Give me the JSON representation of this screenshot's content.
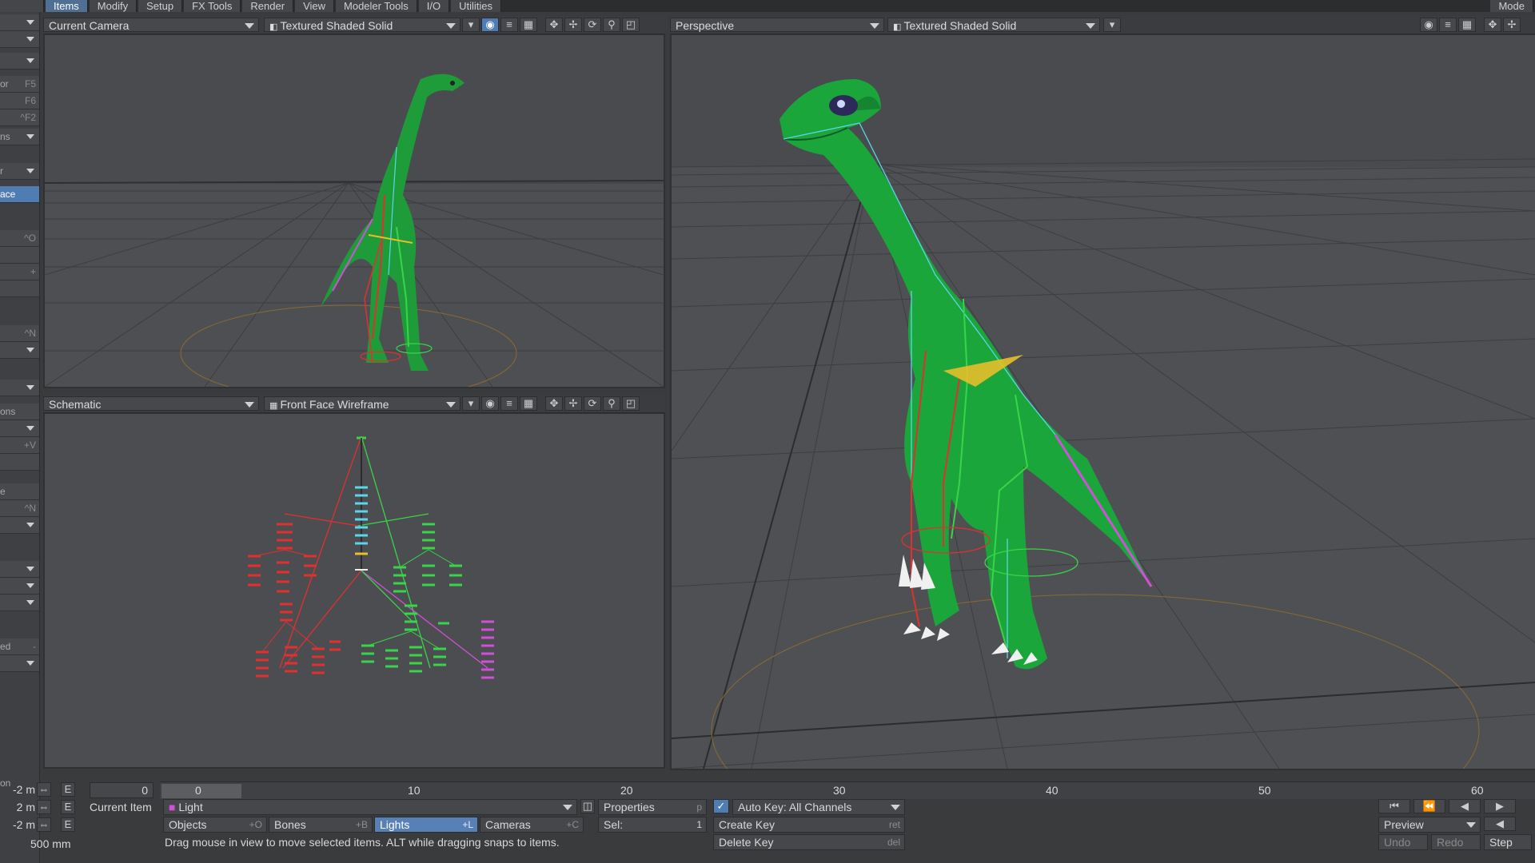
{
  "menu": {
    "tabs": [
      "Items",
      "Modify",
      "Setup",
      "FX Tools",
      "Render",
      "View",
      "Modeler Tools",
      "I/O",
      "Utilities"
    ],
    "right_label": "Mode"
  },
  "left_strip": {
    "shortcut_f5": "F5",
    "shortcut_f6": "F6",
    "shortcut_f2": "^F2",
    "item_or": "or",
    "item_ns": "ns",
    "item_r": "r",
    "item_ace": "ace",
    "shortcut_o": "^O",
    "shortcut_plus": "+",
    "shortcut_n": "^N",
    "item_ons": "ons",
    "shortcut_v": "+V",
    "item_e": "e",
    "shortcut_n2": "^N",
    "item_ed": "ed",
    "item_ed_sc": "-",
    "item_on": "on"
  },
  "viewport_tl": {
    "camera": "Current Camera",
    "render_mode": "Textured Shaded Solid"
  },
  "viewport_bl": {
    "view": "Schematic",
    "render_mode": "Front Face Wireframe"
  },
  "viewport_right": {
    "view": "Perspective",
    "render_mode": "Textured Shaded Solid"
  },
  "timeline": {
    "ticks": [
      "0",
      "10",
      "20",
      "30",
      "40",
      "50",
      "60"
    ],
    "current_frame": "0",
    "frame_field": "0",
    "pos_x": "-2 m",
    "pos_y": "2 m",
    "pos_z": "-2 m",
    "grid_size": "500 mm",
    "e_label": "E",
    "current_item_label": "Current Item",
    "current_item_value": "Light",
    "properties_label": "Properties",
    "properties_shortcut": "p",
    "autokey_label": "Auto Key: All Channels",
    "objects_label": "Objects",
    "objects_shortcut": "+O",
    "bones_label": "Bones",
    "bones_shortcut": "+B",
    "lights_label": "Lights",
    "lights_shortcut": "+L",
    "cameras_label": "Cameras",
    "cameras_shortcut": "+C",
    "sel_label": "Sel:",
    "sel_value": "1",
    "create_key_label": "Create Key",
    "create_key_shortcut": "ret",
    "delete_key_label": "Delete Key",
    "delete_key_shortcut": "del",
    "preview_label": "Preview",
    "undo_label": "Undo",
    "redo_label": "Redo",
    "step_label": "Step",
    "status_text": "Drag mouse in view to move selected items. ALT while dragging snaps to items."
  },
  "colors": {
    "accent": "#4f7cb3",
    "viewport_bg": "#525356",
    "dino_green": "#1aa63a",
    "bone_red": "#e03030",
    "bone_green": "#39d44a",
    "bone_cyan": "#5ad6e8",
    "bone_magenta": "#d050d8"
  }
}
